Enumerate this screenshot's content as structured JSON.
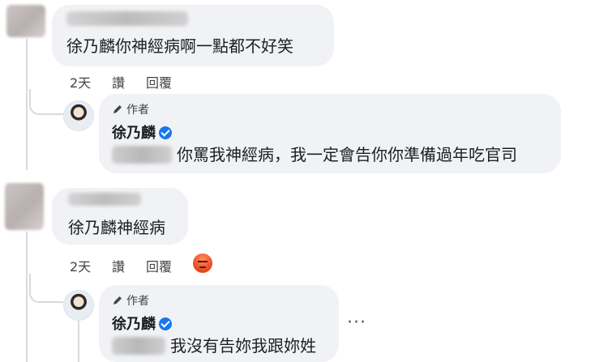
{
  "comments": [
    {
      "text": "徐乃麟你神經病啊一點都不好笑",
      "time": "2天",
      "like_label": "讚",
      "reply_label": "回覆",
      "reply": {
        "badge": "作者",
        "author": "徐乃麟",
        "text": "你罵我神經病，我一定會告你你準備過年吃官司"
      }
    },
    {
      "text": "徐乃麟神經病",
      "time": "2天",
      "like_label": "讚",
      "reply_label": "回覆",
      "reaction_icon": "angry-reaction-icon",
      "reply": {
        "badge": "作者",
        "author": "徐乃麟",
        "text": "我沒有告妳我跟妳姓"
      },
      "more_label": "···"
    }
  ],
  "colors": {
    "bubble": "#f0f2f5",
    "verified": "#1877f2",
    "thread_line": "#d8dadf"
  }
}
